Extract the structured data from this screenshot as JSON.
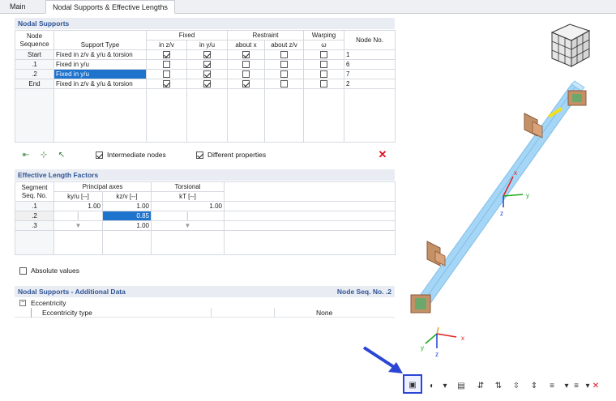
{
  "tabs": [
    {
      "label": "Main"
    },
    {
      "label": "Nodal Supports & Effective Lengths"
    }
  ],
  "nodal_supports": {
    "title": "Nodal Supports",
    "headers": {
      "node_sequence": "Node Sequence",
      "support_type": "Support Type",
      "fixed": "Fixed",
      "fixed_in_zv": "in z/v",
      "fixed_in_yu": "in y/u",
      "restraint": "Restraint",
      "about_x": "about x",
      "about_zv": "about z/v",
      "warping": "Warping",
      "omega": "ω",
      "node_no": "Node No."
    },
    "rows": [
      {
        "seq": "Start",
        "type": "Fixed in z/v & y/u & torsion",
        "fz": true,
        "fy": true,
        "rx": true,
        "rz": false,
        "w": false,
        "node": "1"
      },
      {
        "seq": ".1",
        "type": "Fixed in y/u",
        "fz": false,
        "fy": true,
        "rx": false,
        "rz": false,
        "w": false,
        "node": "6"
      },
      {
        "seq": ".2",
        "type": "Fixed in y/u",
        "fz": false,
        "fy": true,
        "rx": false,
        "rz": false,
        "w": false,
        "node": "7"
      },
      {
        "seq": "End",
        "type": "Fixed in z/v & y/u & torsion",
        "fz": true,
        "fy": true,
        "rx": true,
        "rz": false,
        "w": false,
        "node": "2"
      }
    ],
    "intermediate_nodes_label": "Intermediate nodes",
    "different_properties_label": "Different properties"
  },
  "effective_length": {
    "title": "Effective Length Factors",
    "headers": {
      "segment": "Segment Seq. No.",
      "principal_axes": "Principal axes",
      "kyu": "ky/u [--]",
      "kzv": "kz/v [--]",
      "torsional": "Torsional",
      "kt": "kT [--]"
    },
    "rows": [
      {
        "seq": ".1",
        "kyu": "1.00",
        "kzv": "1.00",
        "kt": "1.00"
      },
      {
        "seq": ".2",
        "kyu": "",
        "kzv": "0.85",
        "kt": ""
      },
      {
        "seq": ".3",
        "kyu": "",
        "kzv": "1.00",
        "kt": ""
      }
    ],
    "absolute_values_label": "Absolute values"
  },
  "additional_data": {
    "title": "Nodal Supports - Additional Data",
    "node_seq": "Node Seq. No. .2",
    "group": "Eccentricity",
    "item_label": "Eccentricity type",
    "item_value": "None"
  },
  "view": {
    "axis_x": "x",
    "axis_y": "y",
    "axis_z": "z"
  },
  "colors": {
    "accent": "#2f5496",
    "selection": "#1e73cc",
    "annotation": "#2b45d4",
    "delete": "#dd1122"
  }
}
